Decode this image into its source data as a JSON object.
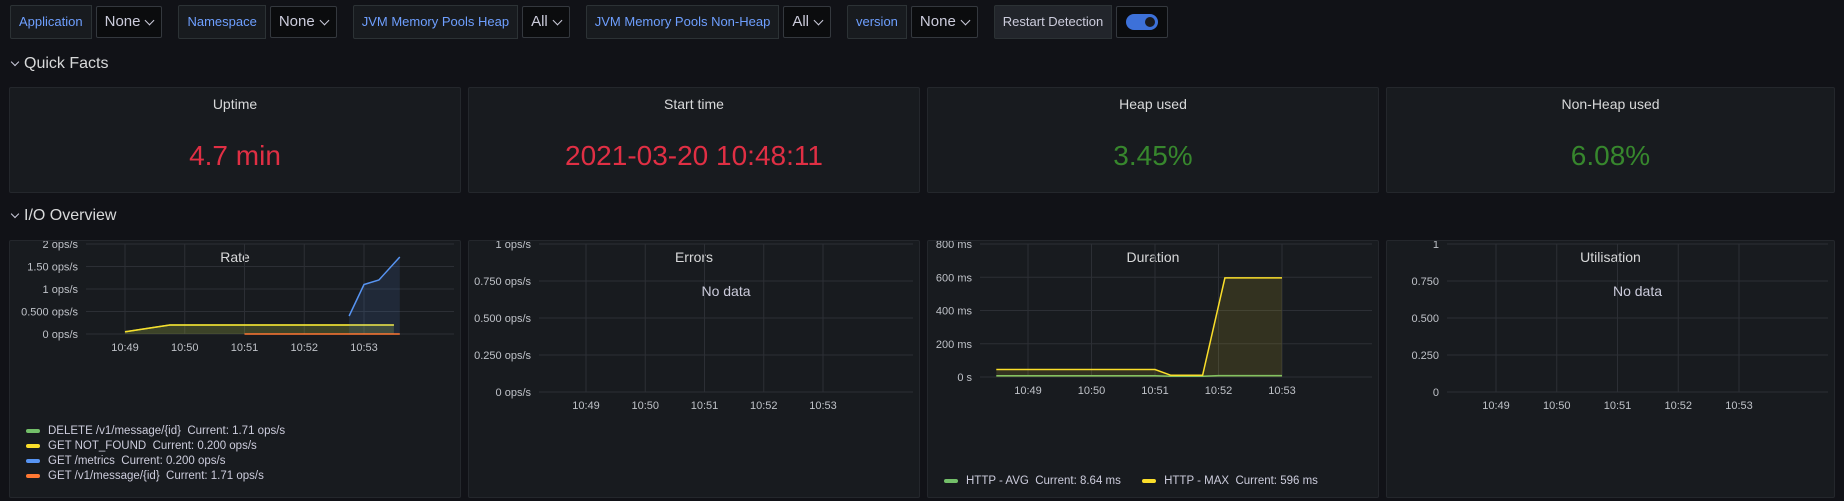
{
  "variables": [
    {
      "label": "Application",
      "value": "None"
    },
    {
      "label": "Namespace",
      "value": "None"
    },
    {
      "label": "JVM Memory Pools Heap",
      "value": "All"
    },
    {
      "label": "JVM Memory Pools Non-Heap",
      "value": "All"
    },
    {
      "label": "version",
      "value": "None"
    }
  ],
  "restart_detection": {
    "label": "Restart Detection",
    "enabled": true
  },
  "rows": {
    "quick_facts": "Quick Facts",
    "io_overview": "I/O Overview"
  },
  "stats": [
    {
      "title": "Uptime",
      "value": "4.7 min",
      "color": "#e02f44"
    },
    {
      "title": "Start time",
      "value": "2021-03-20 10:48:11",
      "color": "#e02f44"
    },
    {
      "title": "Heap used",
      "value": "3.45%",
      "color": "#37872d"
    },
    {
      "title": "Non-Heap used",
      "value": "6.08%",
      "color": "#37872d"
    }
  ],
  "panels": {
    "rate": "Rate",
    "errors": "Errors",
    "duration": "Duration",
    "utilisation": "Utilisation",
    "no_data": "No data"
  },
  "chart_data": [
    {
      "type": "area",
      "title": "Rate",
      "x": [
        "10:48:30",
        "10:49",
        "10:49:15",
        "10:49:30",
        "10:50",
        "10:50:30",
        "10:51",
        "10:51:30",
        "10:52",
        "10:52:15",
        "10:52:30",
        "10:52:45",
        "10:53"
      ],
      "x_ticks": [
        "10:49",
        "10:50",
        "10:51",
        "10:52",
        "10:53"
      ],
      "y_ticks": [
        "0 ops/s",
        "0.500 ops/s",
        "1 ops/s",
        "1.50 ops/s",
        "2 ops/s"
      ],
      "ylim": [
        0,
        2
      ],
      "grid": true,
      "legend_position": "bottom",
      "series": [
        {
          "name": "DELETE /v1/message/{id}",
          "current": "Current: 1.71 ops/s",
          "color": "#73bf69",
          "points": [
            [
              0,
              0.05
            ],
            [
              0.5,
              0.15
            ],
            [
              0.75,
              0.2
            ],
            [
              1,
              0.2
            ],
            [
              1.5,
              0.2
            ],
            [
              2,
              0.2
            ],
            [
              2.5,
              0.2
            ],
            [
              3,
              0.2
            ],
            [
              3.5,
              0.2
            ],
            [
              3.75,
              0.2
            ],
            [
              4,
              0.2
            ],
            [
              4.25,
              0.2
            ],
            [
              4.5,
              0.2
            ]
          ]
        },
        {
          "name": "GET NOT_FOUND",
          "current": "Current: 0.200 ops/s",
          "color": "#fade2a",
          "points": [
            [
              0,
              0.05
            ],
            [
              0.5,
              0.15
            ],
            [
              0.75,
              0.2
            ],
            [
              1,
              0.2
            ],
            [
              1.5,
              0.2
            ],
            [
              2,
              0.2
            ],
            [
              2.5,
              0.2
            ],
            [
              3,
              0.2
            ],
            [
              3.5,
              0.2
            ],
            [
              3.75,
              0.2
            ],
            [
              4,
              0.2
            ],
            [
              4.25,
              0.2
            ],
            [
              4.5,
              0.2
            ]
          ]
        },
        {
          "name": "GET /metrics",
          "current": "Current: 0.200 ops/s",
          "color": "#5794f2",
          "points": [
            [
              3.75,
              0.4
            ],
            [
              4,
              1.1
            ],
            [
              4.25,
              1.2
            ],
            [
              4.6,
              1.71
            ]
          ]
        },
        {
          "name": "GET /v1/message/{id}",
          "current": "Current: 1.71 ops/s",
          "color": "#ff7833",
          "points": [
            [
              2,
              0
            ],
            [
              2.5,
              0
            ],
            [
              3,
              0
            ],
            [
              3.5,
              0
            ],
            [
              4,
              0
            ],
            [
              4.6,
              0
            ]
          ]
        }
      ]
    },
    {
      "type": "line",
      "title": "Errors",
      "x_ticks": [
        "10:49",
        "10:50",
        "10:51",
        "10:52",
        "10:53"
      ],
      "y_ticks": [
        "0 ops/s",
        "0.250 ops/s",
        "0.500 ops/s",
        "0.750 ops/s",
        "1 ops/s"
      ],
      "ylim": [
        0,
        1
      ],
      "grid": true,
      "series": []
    },
    {
      "type": "area",
      "title": "Duration",
      "x_ticks": [
        "10:49",
        "10:50",
        "10:51",
        "10:52",
        "10:53"
      ],
      "y_ticks": [
        "0 s",
        "200 ms",
        "400 ms",
        "600 ms",
        "800 ms"
      ],
      "ylim": [
        0,
        800
      ],
      "grid": true,
      "legend_position": "bottom",
      "series": [
        {
          "name": "HTTP - AVG",
          "current": "Current: 8.64 ms",
          "color": "#73bf69",
          "points": [
            [
              -0.5,
              8
            ],
            [
              0,
              8
            ],
            [
              1,
              8
            ],
            [
              2,
              8
            ],
            [
              2.25,
              5
            ],
            [
              2.75,
              5
            ],
            [
              3,
              8.64
            ],
            [
              3.5,
              8.64
            ],
            [
              4,
              8.64
            ]
          ]
        },
        {
          "name": "HTTP - MAX",
          "current": "Current: 596 ms",
          "color": "#fade2a",
          "points": [
            [
              -0.5,
              45
            ],
            [
              0,
              45
            ],
            [
              1,
              45
            ],
            [
              2,
              45
            ],
            [
              2.25,
              10
            ],
            [
              2.75,
              10
            ],
            [
              3.1,
              596
            ],
            [
              3.5,
              596
            ],
            [
              4,
              596
            ]
          ]
        }
      ]
    },
    {
      "type": "line",
      "title": "Utilisation",
      "x_ticks": [
        "10:49",
        "10:50",
        "10:51",
        "10:52",
        "10:53"
      ],
      "y_ticks": [
        "0",
        "0.250",
        "0.500",
        "0.750",
        "1"
      ],
      "ylim": [
        0,
        1
      ],
      "grid": true,
      "series": []
    }
  ]
}
